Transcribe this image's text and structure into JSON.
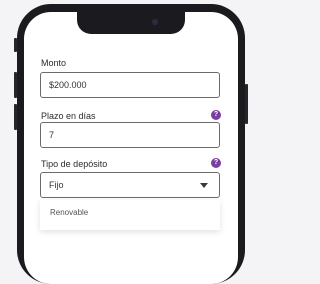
{
  "form": {
    "amount": {
      "label": "Monto",
      "value": "$200.000"
    },
    "term": {
      "label": "Plazo en días",
      "value": "7",
      "help_icon": "question-circle-icon"
    },
    "deposit_type": {
      "label": "Tipo de depósito",
      "selected": "Fijo",
      "help_icon": "question-circle-icon",
      "options": [
        "Renovable"
      ]
    }
  },
  "colors": {
    "accent": "#7b3fa3",
    "phone_frame": "#1b1b1f",
    "background": "#f4f4f6"
  }
}
